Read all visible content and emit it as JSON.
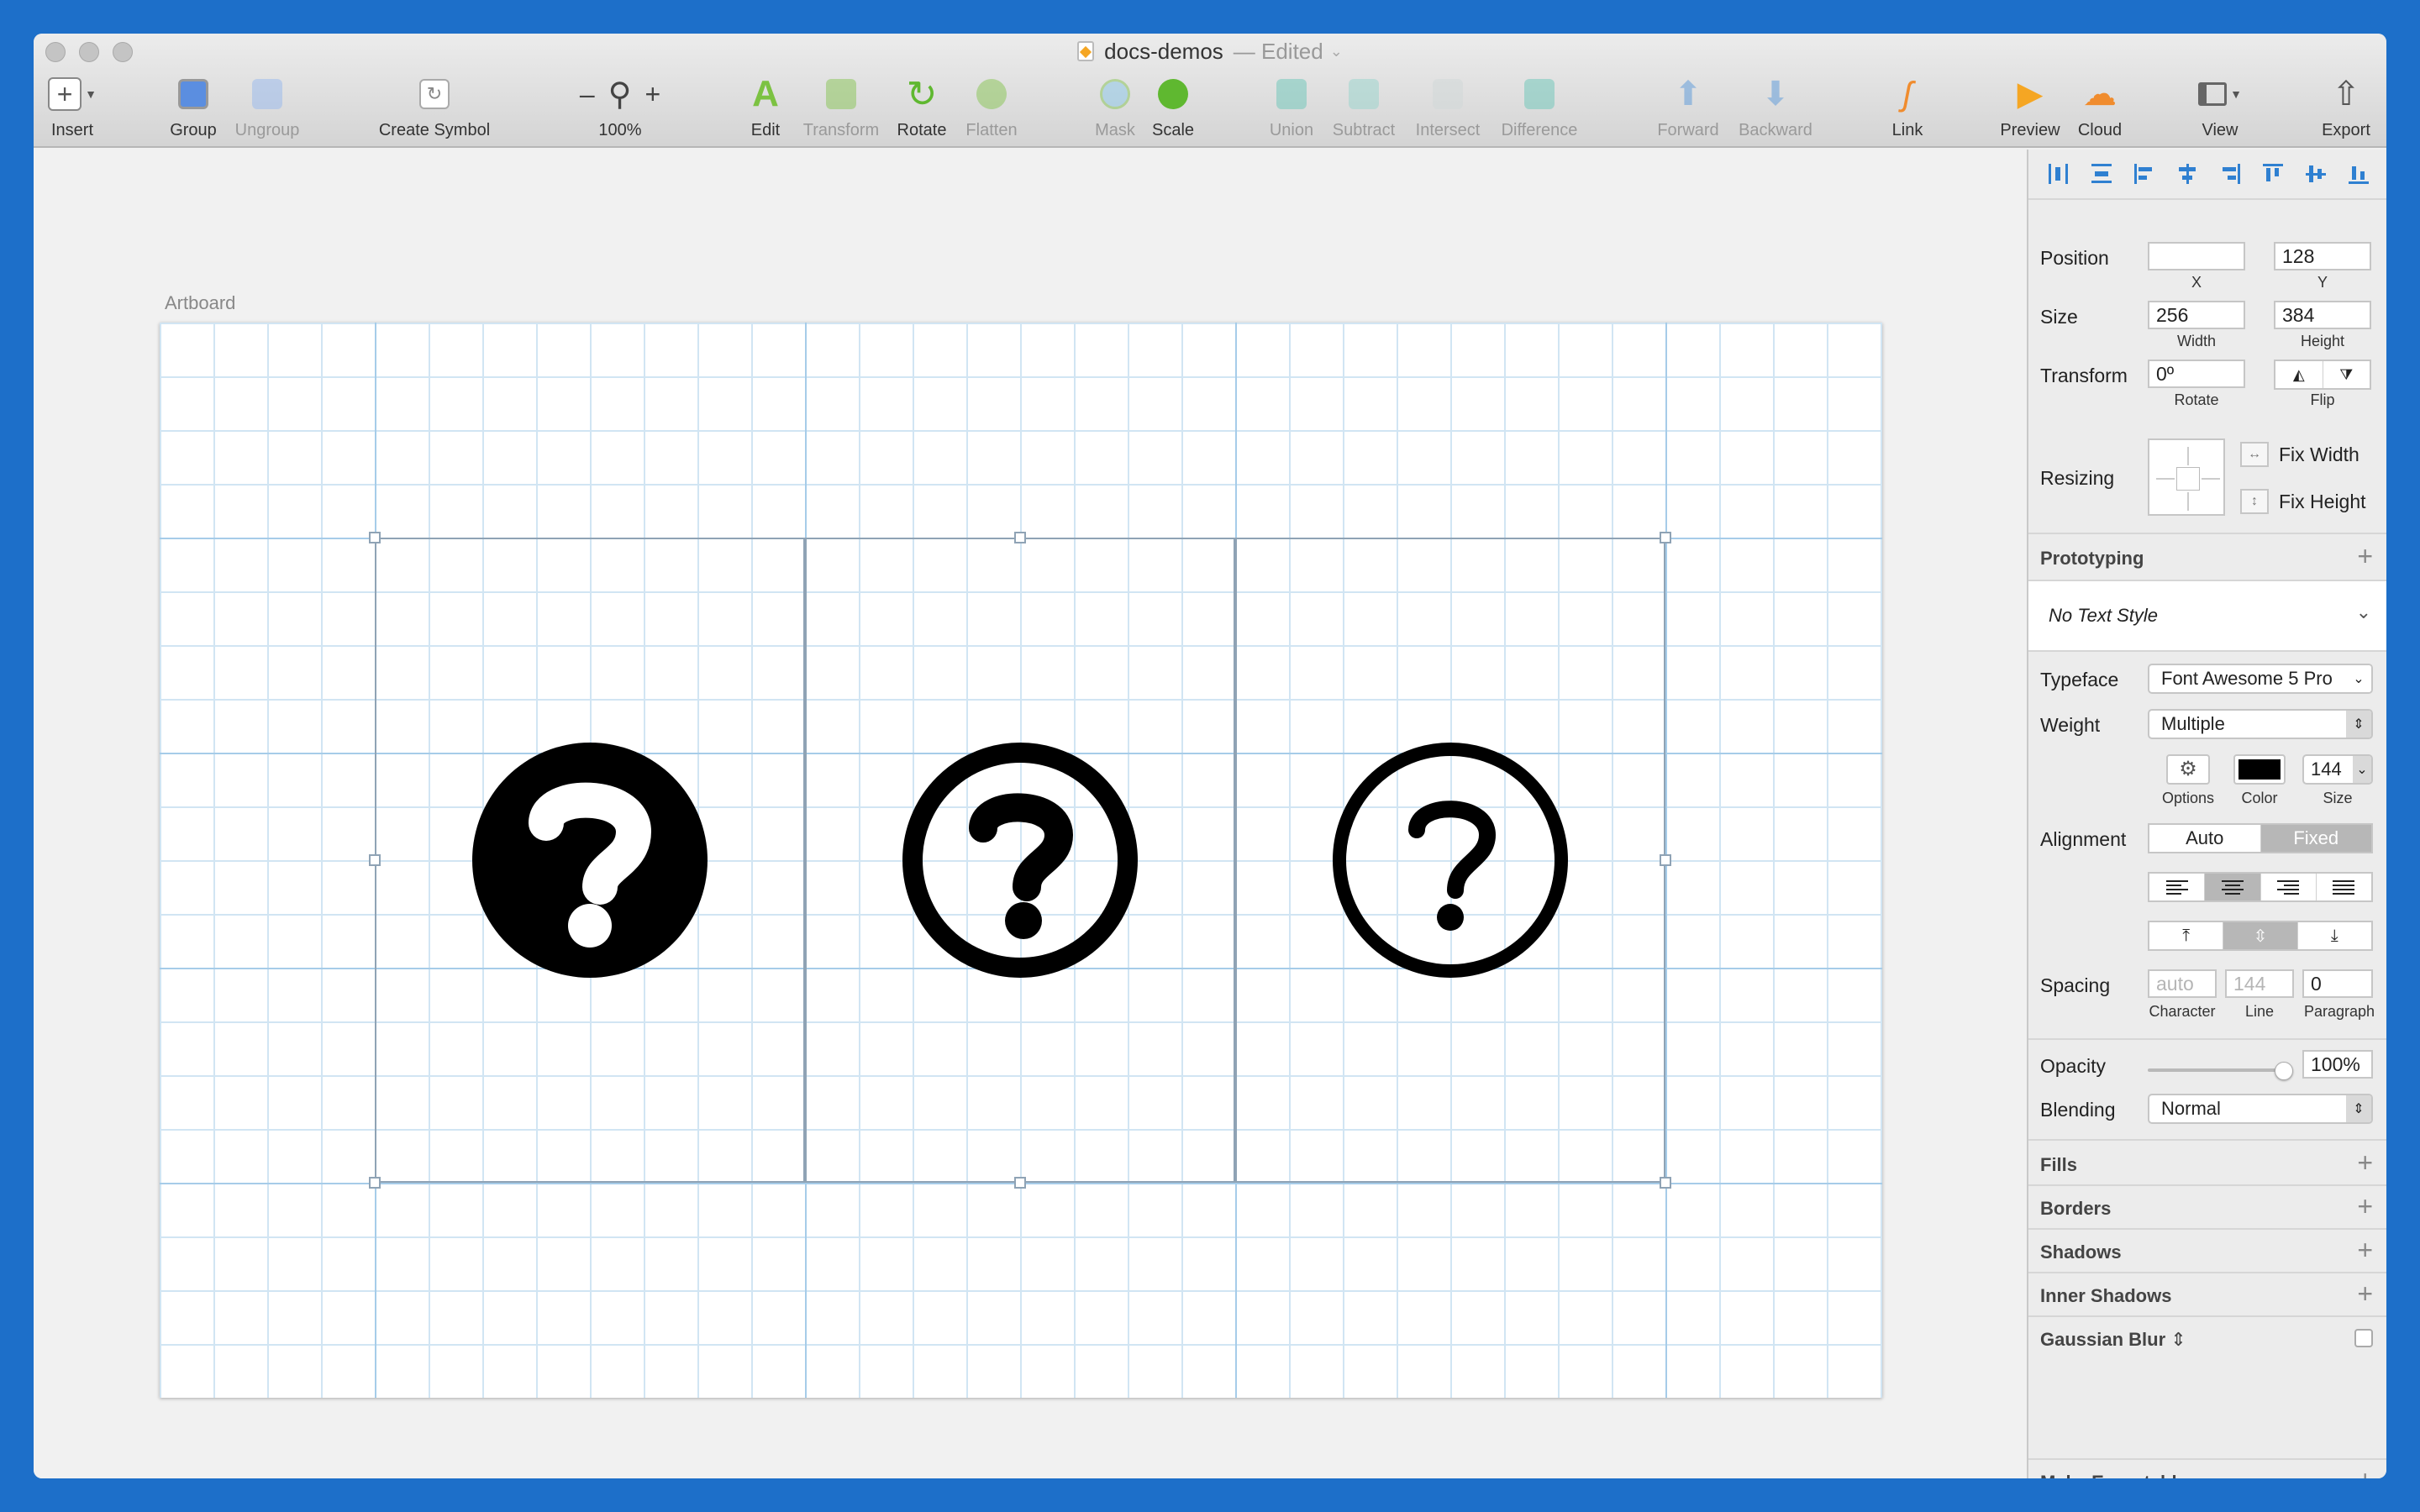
{
  "window": {
    "title": "docs-demos",
    "status": "— Edited"
  },
  "toolbar": {
    "insert": "Insert",
    "group": "Group",
    "ungroup": "Ungroup",
    "create_symbol": "Create Symbol",
    "zoom_minus": "–",
    "zoom_plus": "+",
    "zoom": "100%",
    "edit": "Edit",
    "transform": "Transform",
    "rotate": "Rotate",
    "flatten": "Flatten",
    "mask": "Mask",
    "scale": "Scale",
    "union": "Union",
    "subtract": "Subtract",
    "intersect": "Intersect",
    "difference": "Difference",
    "forward": "Forward",
    "backward": "Backward",
    "link": "Link",
    "preview": "Preview",
    "cloud": "Cloud",
    "view": "View",
    "export": "Export"
  },
  "canvas": {
    "artboard_label": "Artboard"
  },
  "inspector": {
    "position_label": "Position",
    "x_value": "",
    "y_value": "128",
    "x_sub": "X",
    "y_sub": "Y",
    "size_label": "Size",
    "width_value": "256",
    "height_value": "384",
    "width_sub": "Width",
    "height_sub": "Height",
    "transform_label": "Transform",
    "rotate_value": "0º",
    "rotate_sub": "Rotate",
    "flip_sub": "Flip",
    "resizing_label": "Resizing",
    "fix_width": "Fix Width",
    "fix_height": "Fix Height",
    "prototyping": "Prototyping",
    "text_style": "No Text Style",
    "typeface_label": "Typeface",
    "typeface_value": "Font Awesome 5 Pro",
    "weight_label": "Weight",
    "weight_value": "Multiple",
    "options_sub": "Options",
    "color_sub": "Color",
    "size_value": "144",
    "size_sub": "Size",
    "alignment_label": "Alignment",
    "align_auto": "Auto",
    "align_fixed": "Fixed",
    "spacing_label": "Spacing",
    "character_placeholder": "auto",
    "line_placeholder": "144",
    "paragraph_value": "0",
    "character_sub": "Character",
    "line_sub": "Line",
    "paragraph_sub": "Paragraph",
    "opacity_label": "Opacity",
    "opacity_value": "100%",
    "opacity_level": 1.0,
    "blending_label": "Blending",
    "blending_value": "Normal",
    "fills": "Fills",
    "borders": "Borders",
    "shadows": "Shadows",
    "inner_shadows": "Inner Shadows",
    "gaussian_blur": "Gaussian Blur",
    "make_exportable": "Make Exportable"
  },
  "colors": {
    "text_color": "#000000",
    "accent": "#2f80d1",
    "desktop": "#1d6fc9"
  },
  "icons": [
    "question-circle-solid-icon",
    "question-circle-regular-icon",
    "question-circle-light-icon"
  ]
}
